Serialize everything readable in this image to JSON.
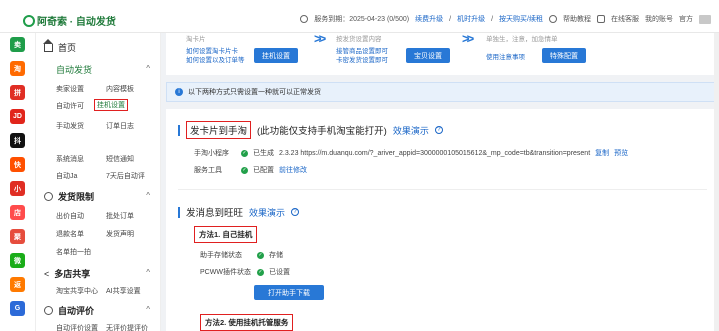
{
  "app": {
    "title": "阿奇索 · 自动发货"
  },
  "header": {
    "service_label": "服务到期：2025-04-23 (0/500)",
    "links": [
      "续费升级",
      "机时升级",
      "按天购买/续租"
    ],
    "sep": "/",
    "help": "帮助教程",
    "online": "在线客服",
    "user": "我的账号",
    "user_tail": "官方"
  },
  "rail": [
    {
      "label": "卖",
      "color": "#1f9d4a"
    },
    {
      "label": "淘",
      "color": "#ff6a00"
    },
    {
      "label": "拼",
      "color": "#e02e24"
    },
    {
      "label": "JD",
      "color": "#e1251b"
    },
    {
      "label": "抖",
      "color": "#111111"
    },
    {
      "label": "快",
      "color": "#ff5000"
    },
    {
      "label": "小",
      "color": "#e02e24"
    },
    {
      "label": "店",
      "color": "#ff4c4c"
    },
    {
      "label": "聚",
      "color": "#e64d3d"
    },
    {
      "label": "微",
      "color": "#1aad19"
    },
    {
      "label": "返",
      "color": "#ff7a00"
    },
    {
      "label": "G",
      "color": "#2c6ad8"
    }
  ],
  "sidebar": {
    "home": "首页",
    "auto_delivery": "自动发货",
    "auto_items": [
      "卖家设置",
      "内容模板",
      "自动许可",
      "挂机设置",
      "手动发货",
      "订单日志"
    ],
    "auto_items2": [
      "系统消息",
      "短信通知",
      "自动Ja",
      "7天后自动评"
    ],
    "limit_title": "发货限制",
    "limit_items": [
      "出价自动",
      "批处订单",
      "退款名单",
      "发货声明",
      "名单拍一拍"
    ],
    "share_title": "多店共享",
    "share_items": [
      "淘宝共享中心",
      "AI共享设置"
    ],
    "review_title": "自动评价",
    "review_items": [
      "自动评价设置",
      "无评价提评价"
    ],
    "chev": "^"
  },
  "cards": {
    "card1_text": "淘卡片",
    "card1_links": [
      "如何设置淘卡片卡",
      "如何设置以及订单等"
    ],
    "card1_btn": "挂机设置",
    "card2_text": "按发货设置内容",
    "card2_links": [
      "接管商品设置即可",
      "卡密发货设置即可"
    ],
    "card2_btn": "宝贝设置",
    "card3_text": "单独生，注意，加急情单",
    "card3_links": [
      "使用注意事项"
    ],
    "card3_btn": "特殊配置",
    "arrow": ">>"
  },
  "notice": "以下两种方式只需设置一种就可以正常发货",
  "section1": {
    "title": "发卡片到手淘",
    "subtitle": "(此功能仅支持手机淘宝能打开)",
    "demo": "效果演示",
    "rows": [
      {
        "label": "手淘小程序",
        "status": "已生成",
        "detail": "2.3.23  https://m.duanqu.com/?_ariver_appid=3000000105015612&_mp_code=tb&transition=present",
        "links": [
          "复制",
          "预览"
        ]
      },
      {
        "label": "服务工具",
        "status": "已配置",
        "detail": "",
        "links": [
          "前往修改"
        ]
      }
    ]
  },
  "section2": {
    "title": "发消息到旺旺",
    "demo": "效果演示",
    "method1": "方法1. 自己挂机",
    "rows": [
      {
        "label": "助手存储状态",
        "status": "存储"
      },
      {
        "label": "PCWW插件状态",
        "status": "已设置"
      }
    ],
    "btn": "打开助手下载",
    "method2": "方法2. 使用挂机托管服务"
  }
}
